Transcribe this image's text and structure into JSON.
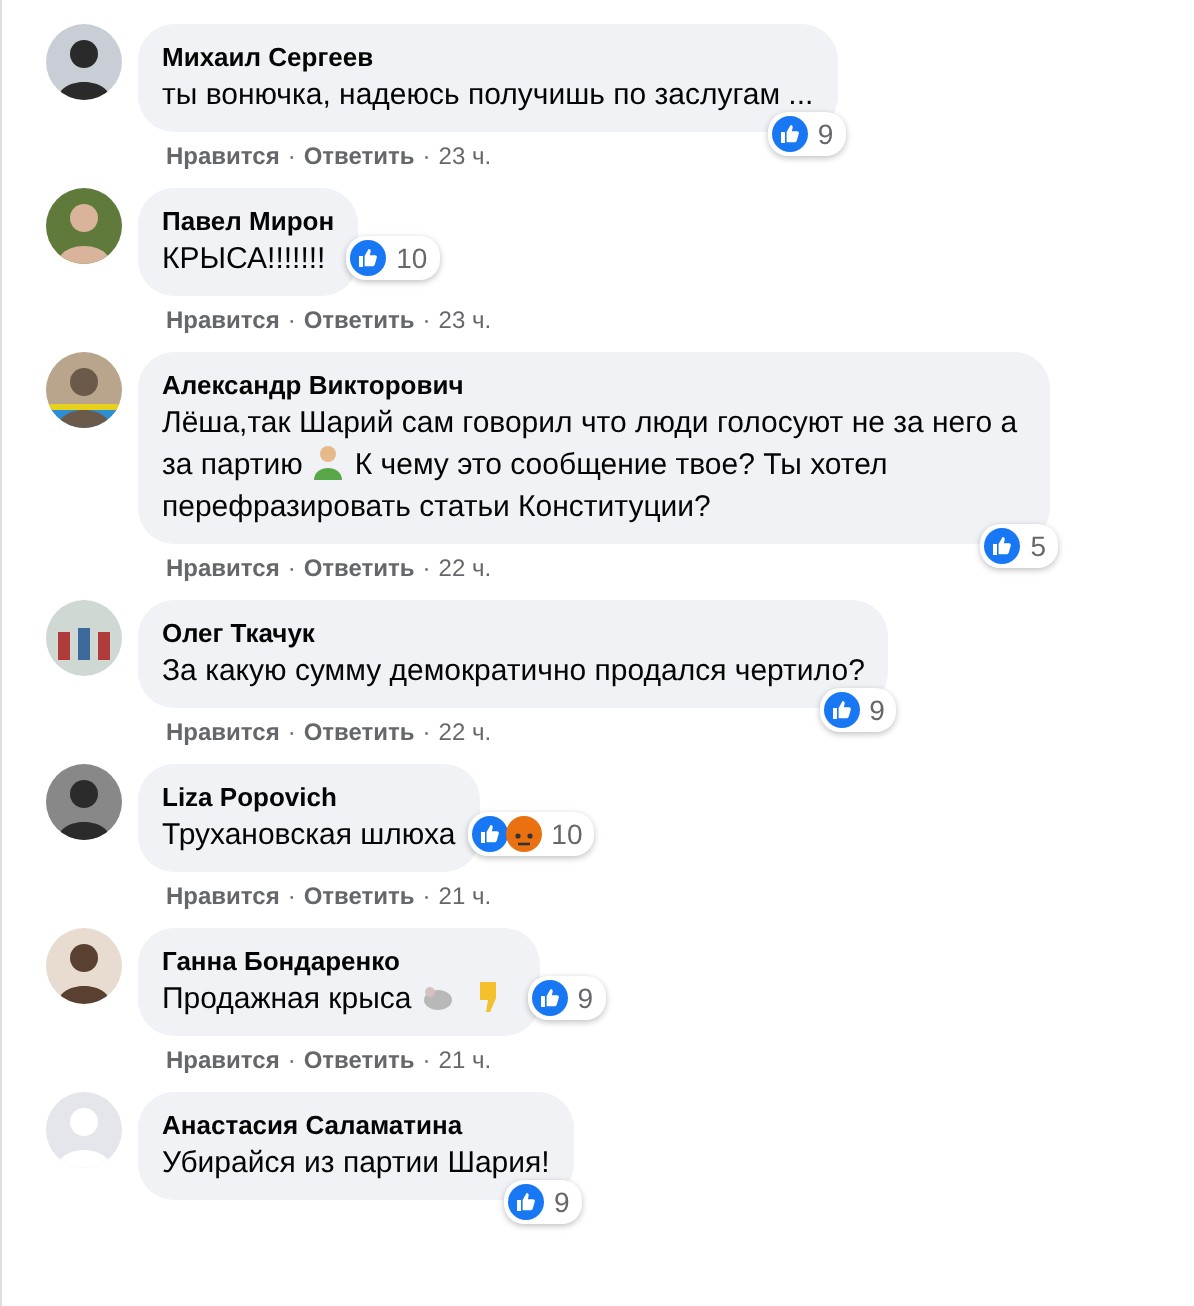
{
  "comments": [
    {
      "author": "Михаил Сергеев",
      "avatar": {
        "kind": "standing-figure"
      },
      "body": [
        {
          "kind": "text",
          "text": "ты вонючка, надеюсь получишь по заслугам ..."
        }
      ],
      "reactions": {
        "kind": "overlap",
        "icons": [
          {
            "kind": "like"
          }
        ],
        "count": "9"
      },
      "meta": [
        {
          "kind": "link",
          "text": "Нравится"
        },
        {
          "kind": "separator",
          "text": "·"
        },
        {
          "kind": "link",
          "text": "Ответить"
        },
        {
          "kind": "separator",
          "text": "·"
        },
        {
          "kind": "time",
          "text": "23 ч."
        }
      ]
    },
    {
      "author": "Павел Мирон",
      "avatar": {
        "kind": "portrait"
      },
      "body": [
        {
          "kind": "text",
          "text": "КРЫСА!!!!!!!"
        }
      ],
      "reactions": {
        "kind": "beside",
        "icons": [
          {
            "kind": "like"
          }
        ],
        "count": "10"
      },
      "meta": [
        {
          "kind": "link",
          "text": "Нравится"
        },
        {
          "kind": "separator",
          "text": "·"
        },
        {
          "kind": "link",
          "text": "Ответить"
        },
        {
          "kind": "separator",
          "text": "·"
        },
        {
          "kind": "time",
          "text": "23 ч."
        }
      ]
    },
    {
      "author": "Александр Викторович",
      "avatar": {
        "kind": "colorful"
      },
      "body": [
        {
          "kind": "text",
          "text": "Лёша,так Шарий сам говорил что люди голосуют не за него а за партию"
        },
        {
          "kind": "person-emoji"
        },
        {
          "kind": "text",
          "text": "К чему это сообщение твое? Ты хотел перефразировать статьи Конституции?"
        }
      ],
      "reactions": {
        "kind": "overlap",
        "icons": [
          {
            "kind": "like"
          }
        ],
        "count": "5"
      },
      "meta": [
        {
          "kind": "link",
          "text": "Нравится"
        },
        {
          "kind": "separator",
          "text": "·"
        },
        {
          "kind": "link",
          "text": "Ответить"
        },
        {
          "kind": "separator",
          "text": "·"
        },
        {
          "kind": "time",
          "text": "22 ч."
        }
      ]
    },
    {
      "author": "Олег Ткачук",
      "avatar": {
        "kind": "group"
      },
      "body": [
        {
          "kind": "text",
          "text": "За какую сумму демократично продался чертило?"
        }
      ],
      "reactions": {
        "kind": "overlap",
        "icons": [
          {
            "kind": "like"
          }
        ],
        "count": "9"
      },
      "meta": [
        {
          "kind": "link",
          "text": "Нравится"
        },
        {
          "kind": "separator",
          "text": "·"
        },
        {
          "kind": "link",
          "text": "Ответить"
        },
        {
          "kind": "separator",
          "text": "·"
        },
        {
          "kind": "time",
          "text": "22 ч."
        }
      ]
    },
    {
      "author": "Liza Popovich",
      "avatar": {
        "kind": "portrait-dark"
      },
      "body": [
        {
          "kind": "text",
          "text": "Трухановская шлюха"
        }
      ],
      "reactions": {
        "kind": "beside",
        "icons": [
          {
            "kind": "like"
          },
          {
            "kind": "angry"
          }
        ],
        "count": "10"
      },
      "meta": [
        {
          "kind": "link",
          "text": "Нравится"
        },
        {
          "kind": "separator",
          "text": "·"
        },
        {
          "kind": "link",
          "text": "Ответить"
        },
        {
          "kind": "separator",
          "text": "·"
        },
        {
          "kind": "time",
          "text": "21 ч."
        }
      ]
    },
    {
      "author": "Ганна Бондаренко",
      "avatar": {
        "kind": "portrait-light"
      },
      "body": [
        {
          "kind": "text",
          "text": "Продажная крыса"
        },
        {
          "kind": "rat-emoji"
        },
        {
          "kind": "thumbs-down-emoji"
        }
      ],
      "reactions": {
        "kind": "beside",
        "icons": [
          {
            "kind": "like"
          }
        ],
        "count": "9"
      },
      "meta": [
        {
          "kind": "link",
          "text": "Нравится"
        },
        {
          "kind": "separator",
          "text": "·"
        },
        {
          "kind": "link",
          "text": "Ответить"
        },
        {
          "kind": "separator",
          "text": "·"
        },
        {
          "kind": "time",
          "text": "21 ч."
        }
      ]
    },
    {
      "author": "Анастасия Саламатина",
      "avatar": {
        "kind": "placeholder"
      },
      "body": [
        {
          "kind": "text",
          "text": "Убирайся из партии Шария!"
        }
      ],
      "reactions": {
        "kind": "overlap",
        "icons": [
          {
            "kind": "like"
          }
        ],
        "count": "9"
      }
    }
  ]
}
